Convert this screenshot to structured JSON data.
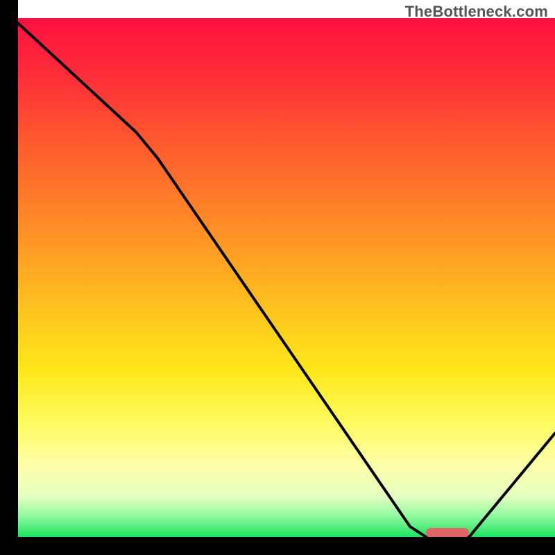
{
  "watermark": "TheBottleneck.com",
  "chart_data": {
    "type": "line",
    "title": "",
    "xlabel": "",
    "ylabel": "",
    "x_range": [
      0,
      100
    ],
    "y_range": [
      0,
      100
    ],
    "gradient_stops": [
      {
        "offset": 0,
        "color": "#ff1040"
      },
      {
        "offset": 10,
        "color": "#ff2a3a"
      },
      {
        "offset": 25,
        "color": "#ff5d2e"
      },
      {
        "offset": 40,
        "color": "#ff8c26"
      },
      {
        "offset": 55,
        "color": "#ffbf1f"
      },
      {
        "offset": 68,
        "color": "#ffe81a"
      },
      {
        "offset": 78,
        "color": "#fffb60"
      },
      {
        "offset": 86,
        "color": "#fdffa8"
      },
      {
        "offset": 92,
        "color": "#e7ffc0"
      },
      {
        "offset": 96,
        "color": "#90f9a0"
      },
      {
        "offset": 100,
        "color": "#1de35e"
      }
    ],
    "series": [
      {
        "name": "bottleneck-curve",
        "points": [
          {
            "x": 0,
            "y": 99
          },
          {
            "x": 22,
            "y": 78
          },
          {
            "x": 26,
            "y": 73
          },
          {
            "x": 73,
            "y": 2
          },
          {
            "x": 76,
            "y": 0
          },
          {
            "x": 84,
            "y": 0
          },
          {
            "x": 100,
            "y": 20
          }
        ]
      }
    ],
    "marker": {
      "x_start": 76,
      "x_end": 84,
      "y": 0.8,
      "color": "#e06666"
    }
  }
}
